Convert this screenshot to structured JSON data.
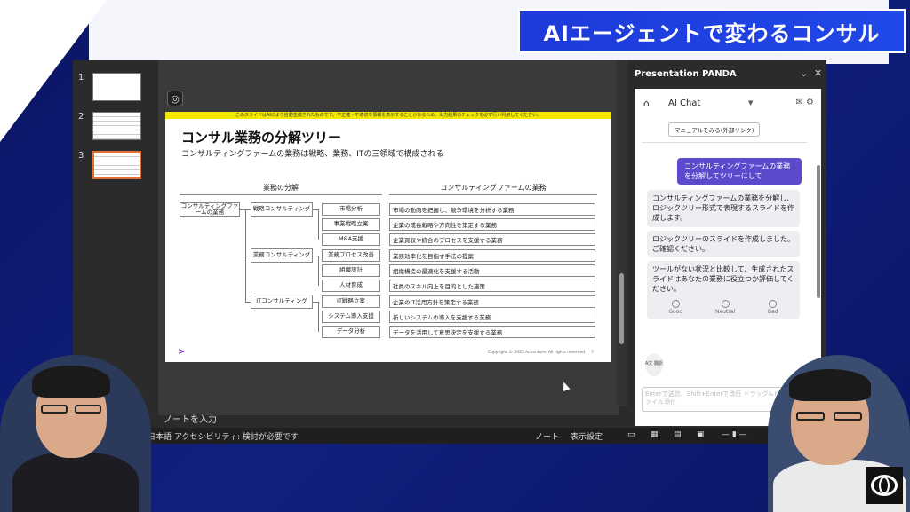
{
  "banner": {
    "title": "AIエージェントで変わるコンサル"
  },
  "thumbnails": [
    {
      "num": "1"
    },
    {
      "num": "2"
    },
    {
      "num": "3"
    }
  ],
  "slide": {
    "notice": "このスライドはAIにより自動生成されたものです。不正確・不適切な情報を表示することがあるため、出力結果のチェックを必ず行い利用してください。",
    "title": "コンサル業務の分解ツリー",
    "subtitle": "コンサルティングファームの業務は戦略、業務、ITの三領域で構成される",
    "left_header": "業務の分解",
    "right_header": "コンサルティングファームの業務",
    "root": "コンサルティングファームの業務",
    "categories": [
      "戦略コンサルティング",
      "業務コンサルティング",
      "ITコンサルティング"
    ],
    "leaves": [
      "市場分析",
      "事業戦略立案",
      "M&A支援",
      "業務プロセス改善",
      "組織設計",
      "人材育成",
      "IT戦略立案",
      "システム導入支援",
      "データ分析"
    ],
    "descriptions": [
      "市場の動向を把握し、競争環境を分析する業務",
      "企業の成長戦略や方向性を策定する業務",
      "企業買収や統合のプロセスを支援する業務",
      "業務効率化を目指す手法の提案",
      "組織構造の最適化を支援する活動",
      "社員のスキル向上を目的とした施策",
      "企業のIT活用方針を策定する業務",
      "新しいシステムの導入を支援する業務",
      "データを活用して意思決定を支援する業務"
    ],
    "footer": "Copyright © 2025 Accenture. All rights reserved.",
    "page": "7",
    "logo": ">"
  },
  "notes_placeholder": "ノートを入力",
  "statusbar": {
    "language": "日本語",
    "accessibility": "アクセシビリティ: 検討が必要です",
    "notes": "ノート",
    "display_settings": "表示設定"
  },
  "panel": {
    "title": "Presentation PANDA",
    "chat_title": "AI Chat",
    "manual_button": "マニュアルをみる(外部リンク)",
    "user_message": "コンサルティングファームの業務を分解してツリーにして",
    "bot_messages": [
      "コンサルティングファームの業務を分解し、ロジックツリー形式で表現するスライドを作成します。",
      "ロジックツリーのスライドを作成しました。ご確認ください。",
      "ツールがない状況と比較して、生成されたスライドはあなたの業務に役立つか評価してください。"
    ],
    "feedback": [
      "Good",
      "Neutral",
      "Bad"
    ],
    "translate_label": "A文 翻訳",
    "input_placeholder": "Enterで送信、Shift+Enterで改行 ドラッグ&ドロップでファイル添付"
  }
}
